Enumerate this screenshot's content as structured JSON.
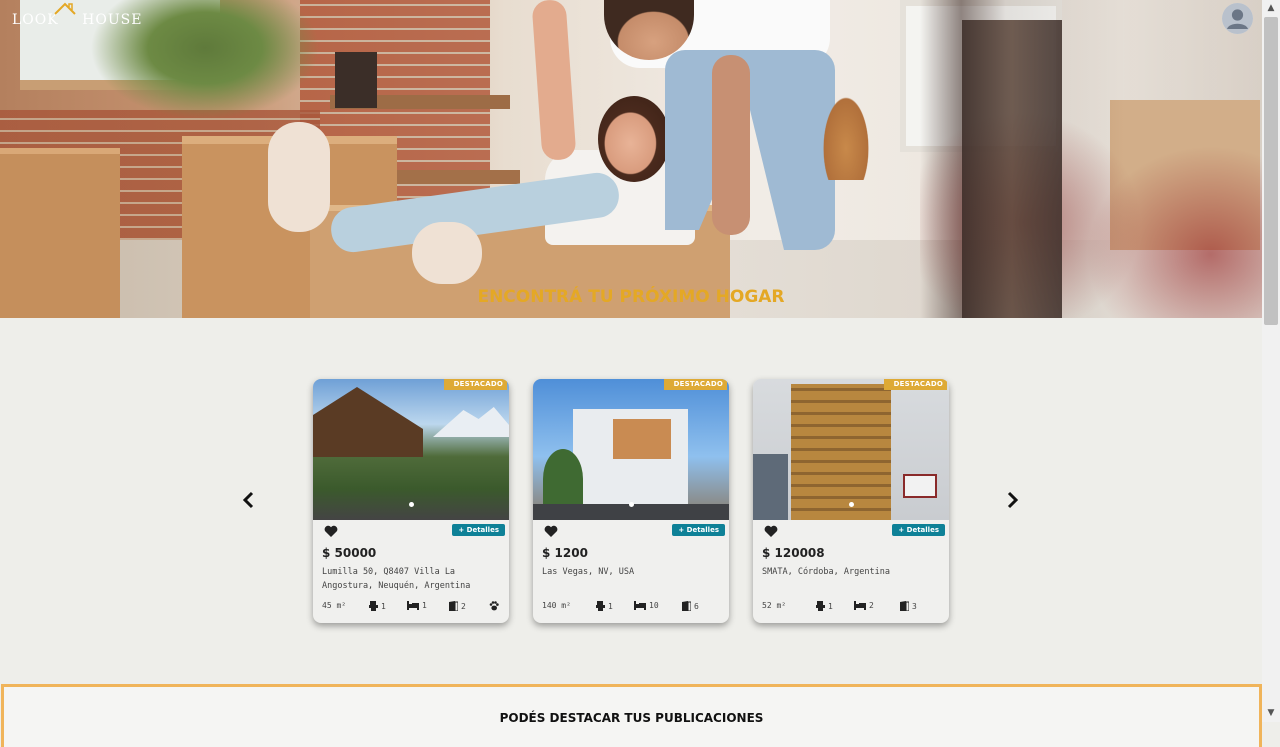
{
  "header": {
    "logo_left": "LOOK",
    "logo_right": "HOUSE",
    "hero_title": "ENCONTRÁ TU PRÓXIMO HOGAR"
  },
  "carousel": {
    "cards": [
      {
        "badge": "DESTACADO",
        "details_label": "+ Detalles",
        "price": "$ 50000",
        "address": "Lumilla 50, Q8407 Villa La Angostura, Neuquén, Argentina",
        "area": "45 m²",
        "baths": "1",
        "beds": "1",
        "rooms": "2",
        "pets": true
      },
      {
        "badge": "DESTACADO",
        "details_label": "+ Detalles",
        "price": "$ 1200",
        "address": "Las Vegas, NV, USA",
        "area": "140 m²",
        "baths": "1",
        "beds": "10",
        "rooms": "6",
        "pets": false
      },
      {
        "badge": "DESTACADO",
        "details_label": "+ Detalles",
        "price": "$ 120008",
        "address": "SMATA, Córdoba, Argentina",
        "area": "52 m²",
        "baths": "1",
        "beds": "2",
        "rooms": "3",
        "pets": false
      }
    ]
  },
  "promo": {
    "title": "PODÉS DESTACAR TUS PUBLICACIONES"
  },
  "colors": {
    "accent": "#e4a825",
    "badge": "#deaa36",
    "details_button": "#0e8197",
    "promo_border": "#f0b45a"
  },
  "icons": [
    "user-avatar-icon",
    "chevron-left-icon",
    "chevron-right-icon",
    "heart-icon",
    "toilet-icon",
    "bed-icon",
    "door-icon",
    "paw-icon"
  ]
}
